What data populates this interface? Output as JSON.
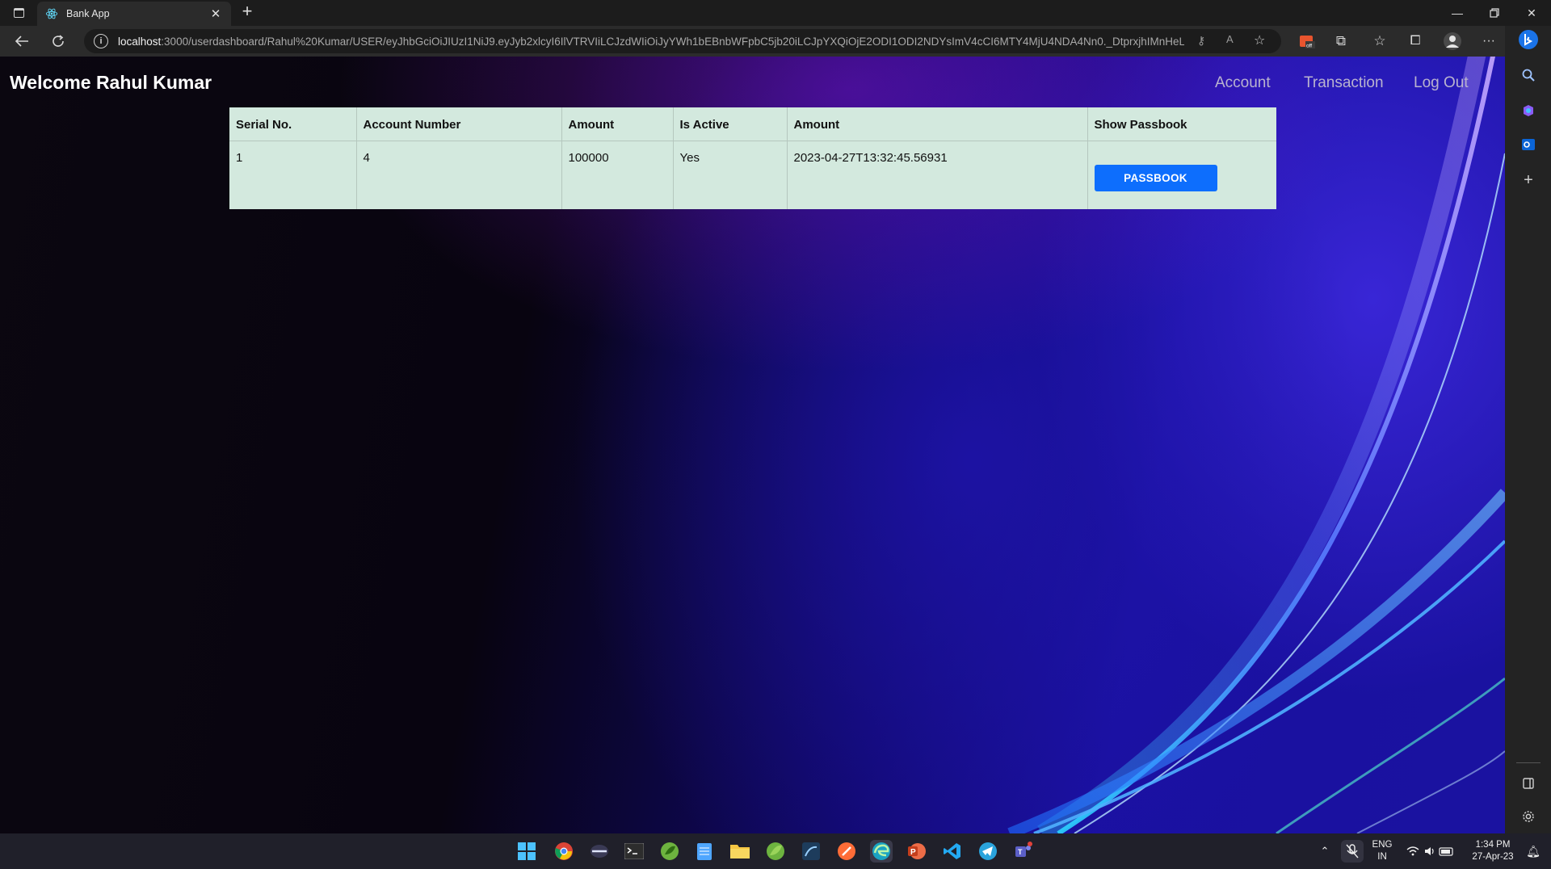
{
  "browser": {
    "tab_title": "Bank App",
    "url_host": "localhost",
    "url_rest": ":3000/userdashboard/Rahul%20Kumar/USER/eyJhbGciOiJIUzI1NiJ9.eyJyb2xlcyI6IlVTRVIiLCJzdWIiOiJyYWh1bEBnbWFpbC5jb20iLCJpYXQiOjE2ODI1ODI2NDYsImV4cCI6MTY4MjU4NDA4Nn0._DtprxjhIMnHeL..."
  },
  "page": {
    "welcome": "Welcome Rahul Kumar",
    "nav": {
      "account": "Account",
      "transaction": "Transaction",
      "logout": "Log Out"
    }
  },
  "table": {
    "headers": [
      "Serial No.",
      "Account Number",
      "Amount",
      "Is Active",
      "Amount",
      "Show Passbook"
    ],
    "rows": [
      {
        "serial": "1",
        "account_number": "4",
        "amount": "100000",
        "is_active": "Yes",
        "date": "2023-04-27T13:32:45.56931",
        "button": "PASSBOOK"
      }
    ]
  },
  "taskbar": {
    "lang_top": "ENG",
    "lang_bottom": "IN",
    "time": "1:34 PM",
    "date": "27-Apr-23"
  },
  "colors": {
    "table_bg": "#d3e9de",
    "button": "#0d6efd",
    "nav_text": "#b9b3cf"
  },
  "icons": [
    "tab-actions-icon",
    "react-favicon-icon",
    "close-icon",
    "plus-icon",
    "back-arrow-icon",
    "refresh-icon",
    "info-icon",
    "search-icon",
    "gear-icon",
    "windows-start-icon"
  ]
}
